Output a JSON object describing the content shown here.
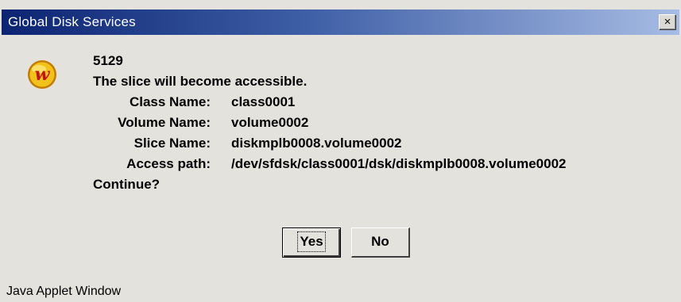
{
  "window": {
    "title": "Global Disk Services",
    "close_glyph": "×"
  },
  "message": {
    "code": "5129",
    "text": "The slice will become accessible.",
    "fields": [
      {
        "label": "Class Name:",
        "value": "class0001"
      },
      {
        "label": "Volume Name:",
        "value": "volume0002"
      },
      {
        "label": "Slice Name:",
        "value": "diskmplb0008.volume0002"
      },
      {
        "label": "Access path:",
        "value": "/dev/sfdsk/class0001/dsk/diskmplb0008.volume0002"
      }
    ],
    "prompt": "Continue?"
  },
  "buttons": {
    "yes_label": "Yes",
    "no_label": "No"
  },
  "statusbar": {
    "text": "Java Applet Window"
  },
  "icon": {
    "name": "app-logo-icon",
    "glyph": "w",
    "colors": {
      "fill": "#f2c21a",
      "ring": "#c47c00",
      "glyph": "#c0141a"
    }
  },
  "colors": {
    "titlebar_start": "#0c2472",
    "titlebar_end": "#a7bce4",
    "window_bg": "#e4e2dc"
  }
}
